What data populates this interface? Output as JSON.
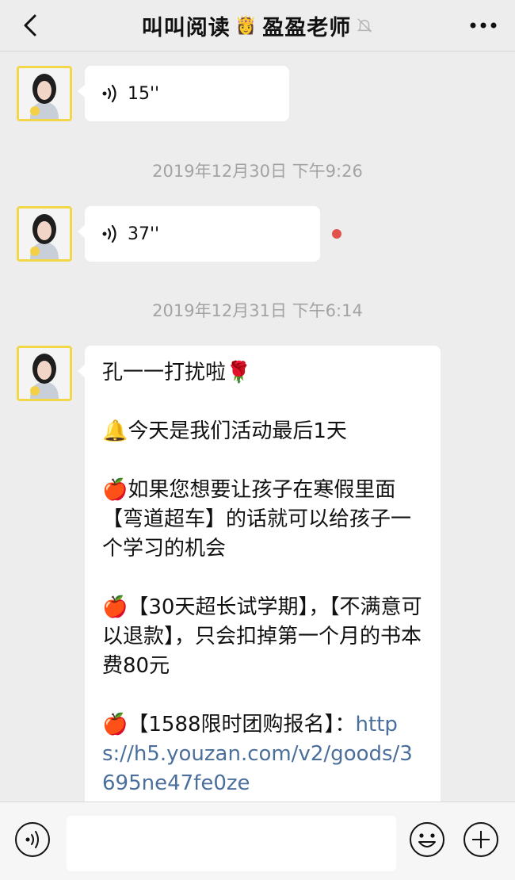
{
  "header": {
    "title_left": "叫叫阅读",
    "crown_emoji": "👸",
    "title_right": "盈盈老师",
    "mute_icon": "🔕"
  },
  "messages": [
    {
      "type": "voice",
      "duration": "15''"
    },
    {
      "type": "timestamp",
      "text": "2019年12月30日 下午9:26"
    },
    {
      "type": "voice",
      "duration": "37''",
      "unread": true
    },
    {
      "type": "timestamp",
      "text": "2019年12月31日 下午6:14"
    },
    {
      "type": "text",
      "lines": [
        "孔一一打扰啦🌹",
        "🔔今天是我们活动最后1天",
        "🍎如果您想要让孩子在寒假里面【弯道超车】的话就可以给孩子一个学习的机会",
        "🍎【30天超长试学期】，【不满意可以退款】，只会扣掉第一个月的书本费80元"
      ],
      "link_prefix": "🍎【1588限时团购报名】：",
      "link": "https://h5.youzan.com/v2/goods/3695ne47fe0ze"
    }
  ],
  "colors": {
    "background": "#ededed",
    "bubble": "#ffffff",
    "avatar_border": "#f2d74b",
    "link": "#4b6f9c",
    "unread_dot": "#e2534c",
    "timestamp": "#a3a3a3"
  },
  "icons": {
    "back": "chevron-left-icon",
    "more": "more-dots-icon",
    "voice_message": "sound-wave-icon",
    "voice_toggle": "voice-toggle-icon",
    "emoji": "emoji-icon",
    "plus": "plus-icon"
  }
}
